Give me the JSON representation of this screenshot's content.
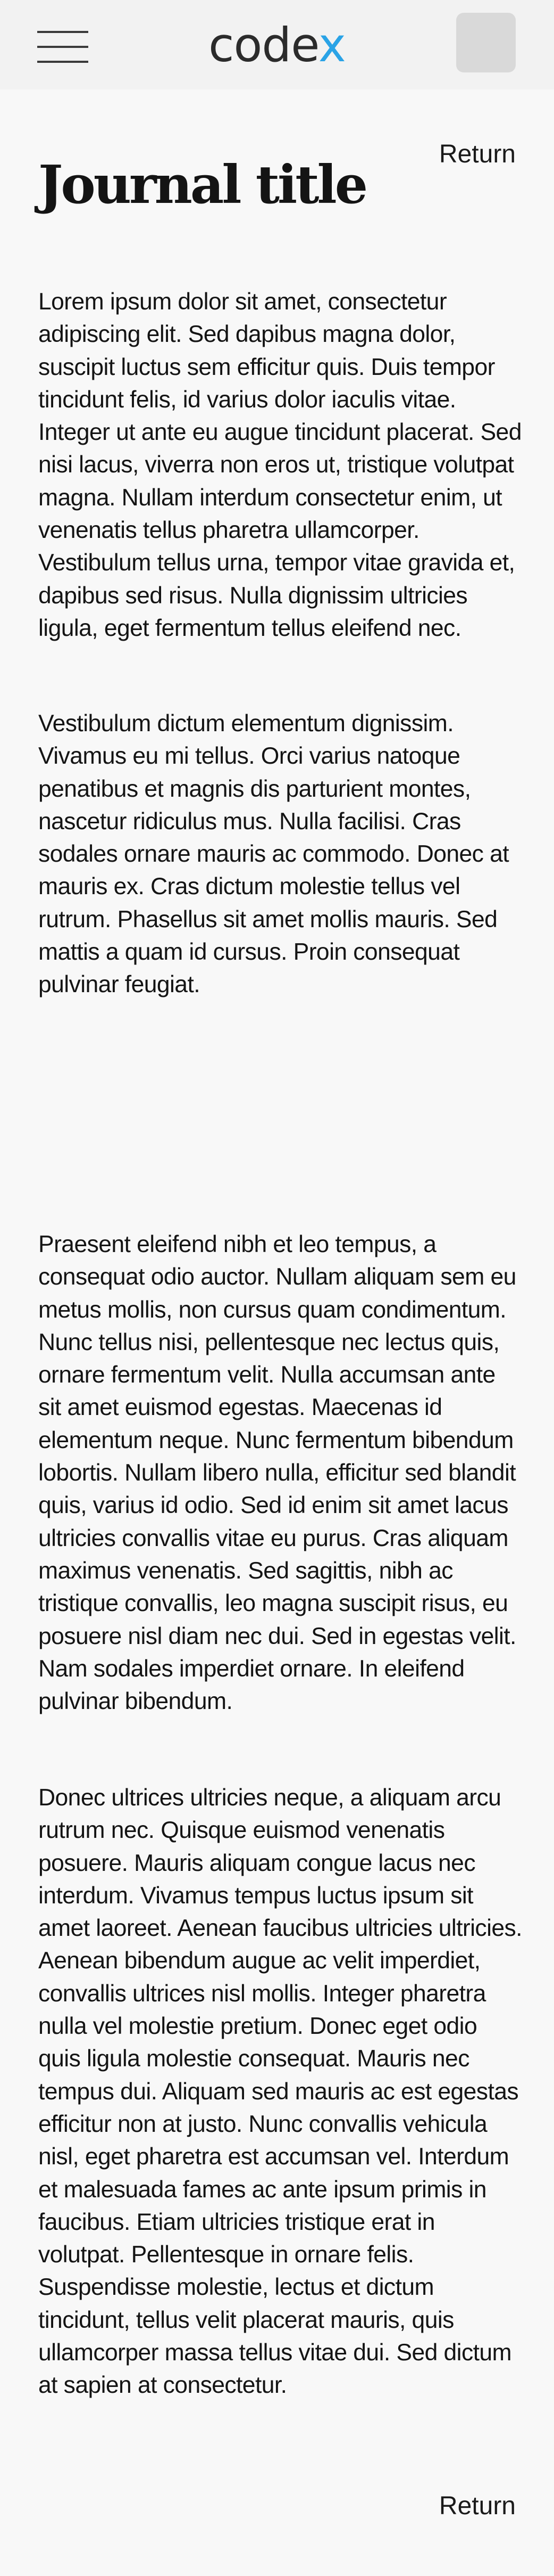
{
  "header": {
    "brand_main": "code",
    "brand_accent": "x"
  },
  "colors": {
    "brand_accent": "#2aa3e6",
    "background": "#f8f8f8",
    "topbar": "#f2f2f2",
    "avatar_placeholder": "#d9d9d9"
  },
  "icons": {
    "menu": "hamburger-menu-icon",
    "avatar": "avatar-placeholder"
  },
  "page": {
    "title": "Journal title",
    "return_top": "Return",
    "return_bottom": "Return"
  },
  "article": {
    "paragraphs": [
      "Lorem ipsum dolor sit amet, consectetur adipiscing elit. Sed dapibus magna dolor, suscipit luctus sem efficitur quis. Duis tempor tincidunt felis, id varius dolor iaculis vitae. Integer ut ante eu augue tincidunt placerat. Sed nisi lacus, viverra non eros ut, tristique volutpat magna. Nullam interdum consectetur enim, ut venenatis tellus pharetra ullamcorper. Vestibulum tellus urna, tempor vitae gravida et, dapibus sed risus. Nulla dignissim ultricies ligula, eget fermentum tellus eleifend nec.",
      "Vestibulum dictum elementum dignissim. Vivamus eu mi tellus. Orci varius natoque penatibus et magnis dis parturient montes, nascetur ridiculus mus. Nulla facilisi. Cras sodales ornare mauris ac commodo. Donec at mauris ex. Cras dictum molestie tellus vel rutrum. Phasellus sit amet mollis mauris. Sed mattis a quam id cursus. Proin consequat pulvinar feugiat.",
      "Praesent eleifend nibh et leo tempus, a consequat odio auctor. Nullam aliquam sem eu metus mollis, non cursus quam condimentum. Nunc tellus nisi, pellentesque nec lectus quis, ornare fermentum velit. Nulla accumsan ante sit amet euismod egestas. Maecenas id elementum neque. Nunc fermentum bibendum lobortis. Nullam libero nulla, efficitur sed blandit quis, varius id odio. Sed id enim sit amet lacus ultricies convallis vitae eu purus. Cras aliquam maximus venenatis. Sed sagittis, nibh ac tristique convallis, leo magna suscipit risus, eu posuere nisl diam nec dui. Sed in egestas velit. Nam sodales imperdiet ornare. In eleifend pulvinar bibendum.",
      "Donec ultrices ultricies neque, a aliquam arcu rutrum nec. Quisque euismod venenatis posuere. Mauris aliquam congue lacus nec interdum. Vivamus tempus luctus ipsum sit amet laoreet. Aenean faucibus ultricies ultricies. Aenean bibendum augue ac velit imperdiet, convallis ultrices nisl mollis. Integer pharetra nulla vel molestie pretium. Donec eget odio quis ligula molestie consequat. Mauris nec tempus dui. Aliquam sed mauris ac est egestas efficitur non at justo. Nunc convallis vehicula nisl, eget pharetra est accumsan vel. Interdum et malesuada fames ac ante ipsum primis in faucibus. Etiam ultricies tristique erat in volutpat. Pellentesque in ornare felis. Suspendisse molestie, lectus et dictum tincidunt, tellus velit placerat mauris, quis ullamcorper massa tellus vitae dui. Sed dictum at sapien at consectetur."
    ]
  }
}
